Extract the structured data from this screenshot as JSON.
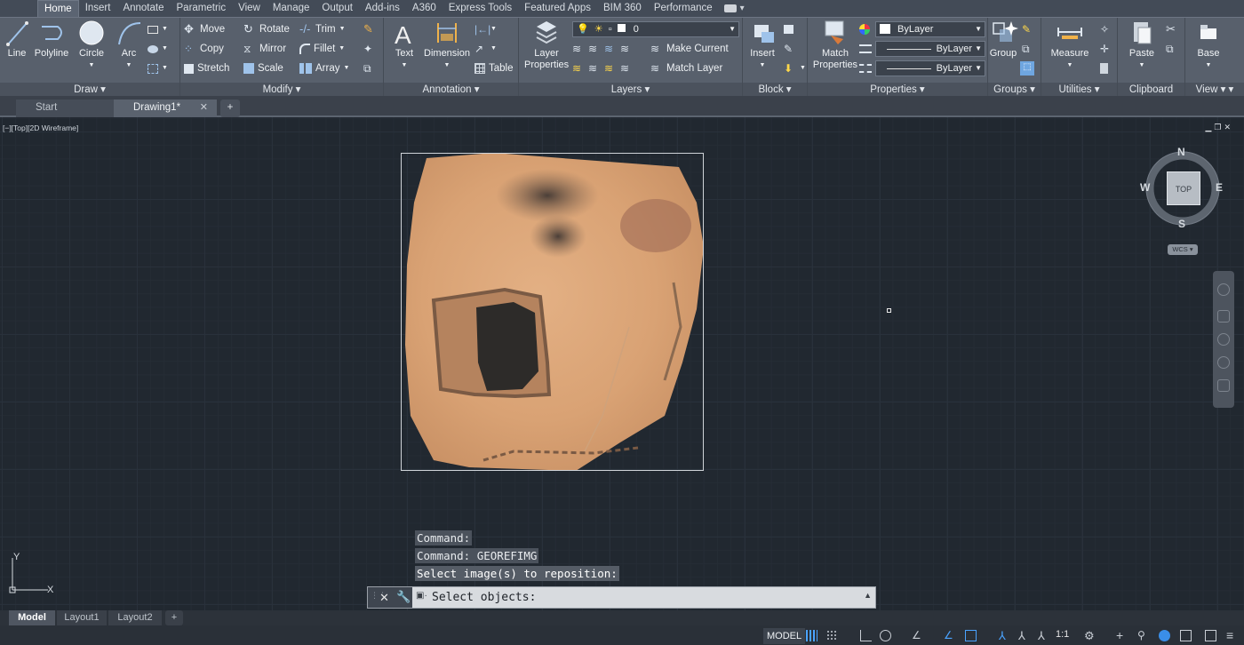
{
  "ribbon_tabs": [
    "Home",
    "Insert",
    "Annotate",
    "Parametric",
    "View",
    "Manage",
    "Output",
    "Add-ins",
    "A360",
    "Express Tools",
    "Featured Apps",
    "BIM 360",
    "Performance"
  ],
  "ribbon": {
    "draw": {
      "title": "Draw",
      "line": "Line",
      "polyline": "Polyline",
      "circle": "Circle",
      "arc": "Arc"
    },
    "modify": {
      "title": "Modify",
      "move": "Move",
      "rotate": "Rotate",
      "trim": "Trim",
      "copy": "Copy",
      "mirror": "Mirror",
      "fillet": "Fillet",
      "stretch": "Stretch",
      "scale": "Scale",
      "array": "Array"
    },
    "annotation": {
      "title": "Annotation",
      "text": "Text",
      "dimension": "Dimension",
      "table": "Table"
    },
    "layers": {
      "title": "Layers",
      "layer_properties_1": "Layer",
      "layer_properties_2": "Properties",
      "layer_value": "0",
      "make_current": "Make Current",
      "match_layer": "Match Layer"
    },
    "block": {
      "title": "Block",
      "insert": "Insert"
    },
    "properties": {
      "title": "Properties",
      "match_1": "Match",
      "match_2": "Properties",
      "color": "ByLayer",
      "linetype": "ByLayer",
      "lineweight": "ByLayer"
    },
    "groups": {
      "title": "Groups",
      "group": "Group"
    },
    "utilities": {
      "title": "Utilities",
      "measure": "Measure"
    },
    "clipboard": {
      "title": "Clipboard",
      "paste": "Paste"
    },
    "view": {
      "title": "View",
      "base": "Base"
    }
  },
  "doc_tabs": {
    "start": "Start",
    "drawing": "Drawing1*"
  },
  "viewport_label": "[−][Top][2D Wireframe]",
  "viewcube": {
    "n": "N",
    "s": "S",
    "e": "E",
    "w": "W",
    "face": "TOP",
    "wcs": "WCS"
  },
  "ucs": {
    "x": "X",
    "y": "Y"
  },
  "command_history": [
    "Command:",
    "Command: GEOREFIMG",
    "Select image(s) to reposition:"
  ],
  "command_prompt": "Select objects:",
  "layout_tabs": [
    "Model",
    "Layout1",
    "Layout2"
  ],
  "status": {
    "model": "MODEL",
    "scale": "1:1"
  }
}
